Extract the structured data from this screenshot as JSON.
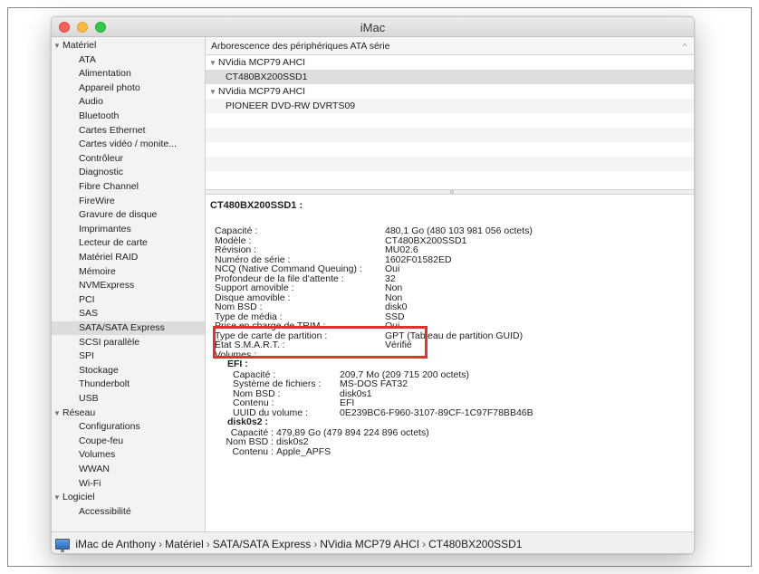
{
  "window": {
    "title": "iMac"
  },
  "sidebar": {
    "rows": [
      {
        "label": "Matériel",
        "group": true
      },
      {
        "label": "ATA"
      },
      {
        "label": "Alimentation"
      },
      {
        "label": "Appareil photo"
      },
      {
        "label": "Audio"
      },
      {
        "label": "Bluetooth"
      },
      {
        "label": "Cartes Ethernet"
      },
      {
        "label": "Cartes vidéo / monite..."
      },
      {
        "label": "Contrôleur"
      },
      {
        "label": "Diagnostic"
      },
      {
        "label": "Fibre Channel"
      },
      {
        "label": "FireWire"
      },
      {
        "label": "Gravure de disque"
      },
      {
        "label": "Imprimantes"
      },
      {
        "label": "Lecteur de carte"
      },
      {
        "label": "Matériel RAID"
      },
      {
        "label": "Mémoire"
      },
      {
        "label": "NVMExpress"
      },
      {
        "label": "PCI"
      },
      {
        "label": "SAS"
      },
      {
        "label": "SATA/SATA Express",
        "selected": true
      },
      {
        "label": "SCSI parallèle"
      },
      {
        "label": "SPI"
      },
      {
        "label": "Stockage"
      },
      {
        "label": "Thunderbolt"
      },
      {
        "label": "USB"
      },
      {
        "label": "Réseau",
        "group": true
      },
      {
        "label": "Configurations"
      },
      {
        "label": "Coupe-feu"
      },
      {
        "label": "Volumes"
      },
      {
        "label": "WWAN"
      },
      {
        "label": "Wi-Fi"
      },
      {
        "label": "Logiciel",
        "group": true
      },
      {
        "label": "Accessibilité"
      }
    ]
  },
  "tree": {
    "header": "Arborescence des périphériques ATA série",
    "rows": [
      {
        "label": "NVidia MCP79 AHCI",
        "level": 0
      },
      {
        "label": "CT480BX200SSD1",
        "level": 1,
        "selected": true
      },
      {
        "label": "NVidia MCP79 AHCI",
        "level": 0
      },
      {
        "label": "PIONEER DVD-RW  DVRTS09",
        "level": 1
      }
    ]
  },
  "detail": {
    "title": "CT480BX200SSD1 :",
    "props": [
      {
        "label": "Capacité :",
        "value": "480,1 Go (480 103 981 056 octets)"
      },
      {
        "label": "Modèle :",
        "value": "CT480BX200SSD1"
      },
      {
        "label": "Révision :",
        "value": "MU02.6"
      },
      {
        "label": "Numéro de série :",
        "value": "1602F01582ED"
      },
      {
        "label": "NCQ (Native Command Queuing) :",
        "value": "Oui"
      },
      {
        "label": "Profondeur de la file d'attente :",
        "value": "32"
      },
      {
        "label": "Support amovible :",
        "value": "Non"
      },
      {
        "label": "Disque amovible :",
        "value": "Non"
      },
      {
        "label": "Nom BSD :",
        "value": "disk0"
      },
      {
        "label": "Type de média :",
        "value": "SSD"
      },
      {
        "label": "Prise en charge de TRIM :",
        "value": "Oui"
      },
      {
        "label": "Type de carte de partition :",
        "value": "GPT (Tableau de partition GUID)"
      },
      {
        "label": "État S.M.A.R.T. :",
        "value": "Vérifié"
      },
      {
        "label": "Volumes :",
        "value": ""
      }
    ],
    "efi": {
      "title": "EFI :",
      "props": [
        {
          "label": "Capacité :",
          "value": "209,7 Mo (209 715 200 octets)"
        },
        {
          "label": "Système de fichiers :",
          "value": "MS-DOS FAT32"
        },
        {
          "label": "Nom BSD :",
          "value": "disk0s1"
        },
        {
          "label": "Contenu :",
          "value": "EFI"
        },
        {
          "label": "UUID du volume :",
          "value": "0E239BC6-F960-3107-89CF-1C97F78BB46B"
        }
      ]
    },
    "disk0s2": {
      "title": "disk0s2 :",
      "props": [
        {
          "label": "Capacité :",
          "value": "479,89 Go (479 894 224 896 octets)"
        },
        {
          "label": "Nom BSD :",
          "value": "disk0s2"
        },
        {
          "label": "Contenu :",
          "value": "Apple_APFS"
        }
      ]
    }
  },
  "statusbar": {
    "crumbs": [
      "iMac de Anthony",
      "Matériel",
      "SATA/SATA Express",
      "NVidia MCP79 AHCI",
      "CT480BX200SSD1"
    ],
    "separator": "›"
  },
  "colors": {
    "highlight": "#e8302a",
    "selection": "#dcdcdc"
  }
}
